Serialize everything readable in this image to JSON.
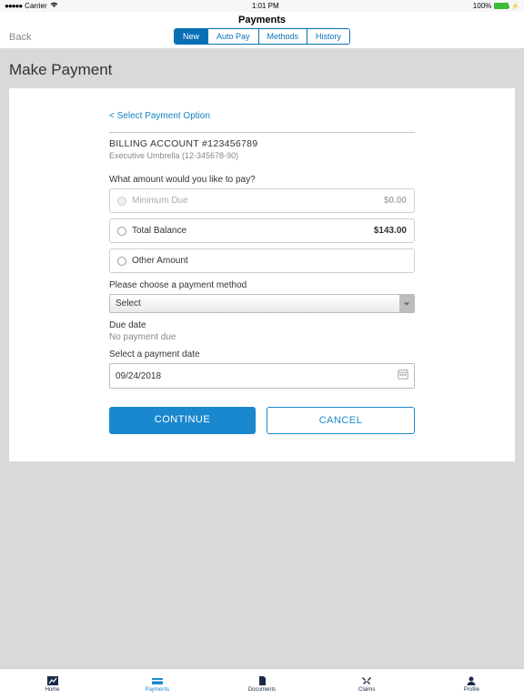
{
  "status": {
    "carrier": "Carrier",
    "time": "1:01 PM",
    "battery": "100%"
  },
  "header": {
    "title": "Payments",
    "back": "Back"
  },
  "tabs": {
    "new": "New",
    "autopay": "Auto Pay",
    "methods": "Methods",
    "history": "History"
  },
  "page": {
    "title": "Make Payment"
  },
  "form": {
    "back_select": "<  Select Payment Option",
    "account": "BILLING ACCOUNT #123456789",
    "subaccount": "Executive Umbrella (12-345678-90)",
    "amount_prompt": "What amount would you like to pay?",
    "opt_min": {
      "label": "Minimum Due",
      "value": "$0.00"
    },
    "opt_total": {
      "label": "Total Balance",
      "value": "$143.00"
    },
    "opt_other": {
      "label": "Other Amount"
    },
    "method_prompt": "Please choose a payment method",
    "method_value": "Select",
    "due_label": "Due date",
    "due_value": "No payment due",
    "date_label": "Select a payment date",
    "date_value": "09/24/2018",
    "continue": "CONTINUE",
    "cancel": "CANCEL"
  },
  "nav": {
    "home": "Home",
    "payments": "Payments",
    "documents": "Documents",
    "claims": "Claims",
    "profile": "Profile"
  }
}
